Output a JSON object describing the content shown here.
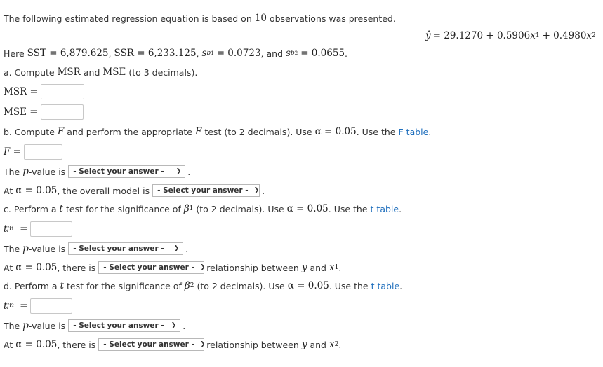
{
  "intro": {
    "text": "The following estimated regression equation is based on",
    "n": "10",
    "text2": "observations was presented."
  },
  "equation": {
    "yhat": "ŷ",
    "eq": "= 29.1270 + 0.5906",
    "x1": "x",
    "x1sub": "1",
    "plus": "+ 0.4980",
    "x2": "x",
    "x2sub": "2"
  },
  "here": {
    "label": "Here",
    "sst": "SST = 6,879.625",
    "ssr": "SSR = 6,233.125",
    "s": "s",
    "b": "b",
    "sub1": "1",
    "sub2": "2",
    "sb1_val": "= 0.0723",
    "and": ", and",
    "sb2_val": "= 0.0655",
    "comma": ",",
    "period": "."
  },
  "part_a": {
    "label": "a. Compute",
    "msr": "MSR",
    "and": "and",
    "mse": "MSE",
    "rest": "(to 3 decimals).",
    "msr_field_label": "MSR =",
    "mse_field_label": "MSE ="
  },
  "part_b": {
    "label": "b. Compute",
    "f": "F",
    "mid": "and perform the appropriate",
    "f2": "F",
    "rest": "test (to 2 decimals). Use",
    "alpha_eq": "α = 0.05",
    "use_the": ". Use the",
    "link": "F table",
    "end": ".",
    "f_field_label": "F =",
    "pvalue_prefix": "The",
    "p": "p",
    "pvalue_suffix": "-value is",
    "pvalue_select": "- Select your answer -",
    "at": "At",
    "alpha": "α = 0.05",
    "model_text": ", the overall model is",
    "model_select": "- Select your answer -"
  },
  "part_c": {
    "label": "c. Perform a",
    "t": "t",
    "mid": "test for the significance of",
    "beta": "β",
    "beta_sub": "1",
    "rest": "(to 2 decimals). Use",
    "alpha_eq": "α = 0.05",
    "use_the": ". Use the",
    "link": "t table",
    "end": ".",
    "t_label": "t",
    "t_sub": "β",
    "t_subsub": "1",
    "eq": "=",
    "pvalue_prefix": "The",
    "p": "p",
    "pvalue_suffix": "-value is",
    "pvalue_select": "- Select your answer -",
    "at": "At",
    "alpha": "α = 0.05",
    "there_is": ", there is",
    "rel_select": "- Select your answer -",
    "relationship": "relationship between",
    "y": "y",
    "and": "and",
    "x": "x",
    "xsub": "1",
    "end2": "."
  },
  "part_d": {
    "label": "d. Perform a",
    "t": "t",
    "mid": "test for the significance of",
    "beta": "β",
    "beta_sub": "2",
    "rest": "(to 2 decimals). Use",
    "alpha_eq": "α = 0.05",
    "use_the": ". Use the",
    "link": "t table",
    "end": ".",
    "t_label": "t",
    "t_sub": "β",
    "t_subsub": "2",
    "eq": "=",
    "pvalue_prefix": "The",
    "p": "p",
    "pvalue_suffix": "-value is",
    "pvalue_select": "- Select your answer -",
    "at": "At",
    "alpha": "α = 0.05",
    "there_is": ", there is",
    "rel_select": "- Select your answer -",
    "relationship": "relationship between",
    "y": "y",
    "and": "and",
    "x": "x",
    "xsub": "2",
    "end2": "."
  },
  "icons": {
    "dropdown": "chevron-down-icon"
  }
}
